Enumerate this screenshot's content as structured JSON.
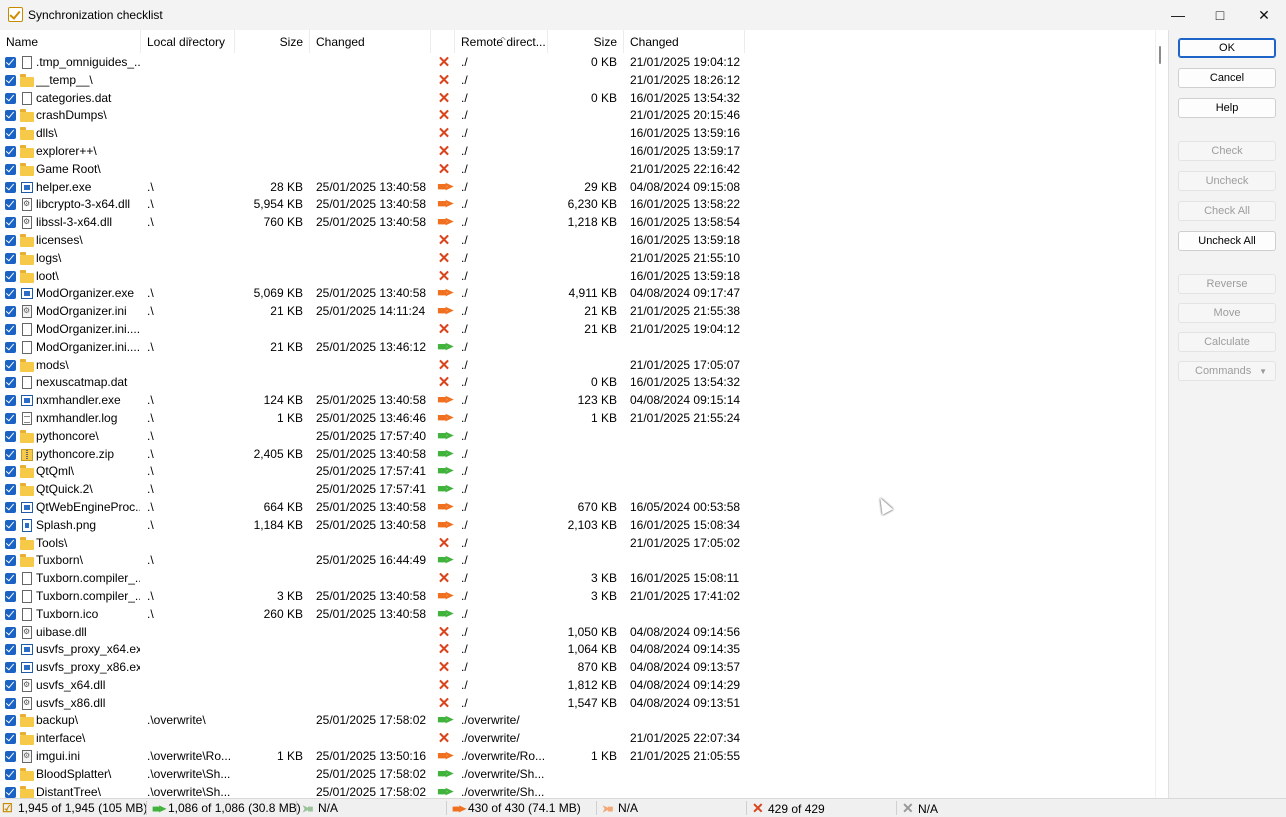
{
  "window": {
    "title": "Synchronization checklist"
  },
  "columns": {
    "name": "Name",
    "local_dir": "Local directory",
    "size": "Size",
    "changed": "Changed",
    "remote_dir": "Remote direct...",
    "remote_size": "Size",
    "remote_changed": "Changed"
  },
  "rows": [
    {
      "name": ".tmp_omniguides_...",
      "icon": "file",
      "ldir": "",
      "lsize": "",
      "lchanged": "",
      "action": "delete",
      "rdir": "./",
      "rsize": "0 KB",
      "rchanged": "21/01/2025 19:04:12"
    },
    {
      "name": "__temp__\\",
      "icon": "folder",
      "ldir": "",
      "lsize": "",
      "lchanged": "",
      "action": "delete",
      "rdir": "./",
      "rsize": "",
      "rchanged": "21/01/2025 18:26:12"
    },
    {
      "name": "categories.dat",
      "icon": "file",
      "ldir": "",
      "lsize": "",
      "lchanged": "",
      "action": "delete",
      "rdir": "./",
      "rsize": "0 KB",
      "rchanged": "16/01/2025 13:54:32"
    },
    {
      "name": "crashDumps\\",
      "icon": "folder",
      "ldir": "",
      "lsize": "",
      "lchanged": "",
      "action": "delete",
      "rdir": "./",
      "rsize": "",
      "rchanged": "21/01/2025 20:15:46"
    },
    {
      "name": "dlls\\",
      "icon": "folder",
      "ldir": "",
      "lsize": "",
      "lchanged": "",
      "action": "delete",
      "rdir": "./",
      "rsize": "",
      "rchanged": "16/01/2025 13:59:16"
    },
    {
      "name": "explorer++\\",
      "icon": "folder",
      "ldir": "",
      "lsize": "",
      "lchanged": "",
      "action": "delete",
      "rdir": "./",
      "rsize": "",
      "rchanged": "16/01/2025 13:59:17"
    },
    {
      "name": "Game Root\\",
      "icon": "folder",
      "ldir": "",
      "lsize": "",
      "lchanged": "",
      "action": "delete",
      "rdir": "./",
      "rsize": "",
      "rchanged": "21/01/2025 22:16:42"
    },
    {
      "name": "helper.exe",
      "icon": "exe",
      "ldir": ".\\",
      "lsize": "28 KB",
      "lchanged": "25/01/2025 13:40:58",
      "action": "update",
      "rdir": "./",
      "rsize": "29 KB",
      "rchanged": "04/08/2024 09:15:08"
    },
    {
      "name": "libcrypto-3-x64.dll",
      "icon": "dll",
      "ldir": ".\\",
      "lsize": "5,954 KB",
      "lchanged": "25/01/2025 13:40:58",
      "action": "update",
      "rdir": "./",
      "rsize": "6,230 KB",
      "rchanged": "16/01/2025 13:58:22"
    },
    {
      "name": "libssl-3-x64.dll",
      "icon": "dll",
      "ldir": ".\\",
      "lsize": "760 KB",
      "lchanged": "25/01/2025 13:40:58",
      "action": "update",
      "rdir": "./",
      "rsize": "1,218 KB",
      "rchanged": "16/01/2025 13:58:54"
    },
    {
      "name": "licenses\\",
      "icon": "folder",
      "ldir": "",
      "lsize": "",
      "lchanged": "",
      "action": "delete",
      "rdir": "./",
      "rsize": "",
      "rchanged": "16/01/2025 13:59:18"
    },
    {
      "name": "logs\\",
      "icon": "folder",
      "ldir": "",
      "lsize": "",
      "lchanged": "",
      "action": "delete",
      "rdir": "./",
      "rsize": "",
      "rchanged": "21/01/2025 21:55:10"
    },
    {
      "name": "loot\\",
      "icon": "folder",
      "ldir": "",
      "lsize": "",
      "lchanged": "",
      "action": "delete",
      "rdir": "./",
      "rsize": "",
      "rchanged": "16/01/2025 13:59:18"
    },
    {
      "name": "ModOrganizer.exe",
      "icon": "exe",
      "ldir": ".\\",
      "lsize": "5,069 KB",
      "lchanged": "25/01/2025 13:40:58",
      "action": "update",
      "rdir": "./",
      "rsize": "4,911 KB",
      "rchanged": "04/08/2024 09:17:47"
    },
    {
      "name": "ModOrganizer.ini",
      "icon": "ini",
      "ldir": ".\\",
      "lsize": "21 KB",
      "lchanged": "25/01/2025 14:11:24",
      "action": "update",
      "rdir": "./",
      "rsize": "21 KB",
      "rchanged": "21/01/2025 21:55:38"
    },
    {
      "name": "ModOrganizer.ini....",
      "icon": "file",
      "ldir": "",
      "lsize": "",
      "lchanged": "",
      "action": "delete",
      "rdir": "./",
      "rsize": "21 KB",
      "rchanged": "21/01/2025 19:04:12"
    },
    {
      "name": "ModOrganizer.ini....",
      "icon": "file",
      "ldir": ".\\",
      "lsize": "21 KB",
      "lchanged": "25/01/2025 13:46:12",
      "action": "new",
      "rdir": "./",
      "rsize": "",
      "rchanged": ""
    },
    {
      "name": "mods\\",
      "icon": "folder",
      "ldir": "",
      "lsize": "",
      "lchanged": "",
      "action": "delete",
      "rdir": "./",
      "rsize": "",
      "rchanged": "21/01/2025 17:05:07"
    },
    {
      "name": "nexuscatmap.dat",
      "icon": "file",
      "ldir": "",
      "lsize": "",
      "lchanged": "",
      "action": "delete",
      "rdir": "./",
      "rsize": "0 KB",
      "rchanged": "16/01/2025 13:54:32"
    },
    {
      "name": "nxmhandler.exe",
      "icon": "exe",
      "ldir": ".\\",
      "lsize": "124 KB",
      "lchanged": "25/01/2025 13:40:58",
      "action": "update",
      "rdir": "./",
      "rsize": "123 KB",
      "rchanged": "04/08/2024 09:15:14"
    },
    {
      "name": "nxmhandler.log",
      "icon": "log",
      "ldir": ".\\",
      "lsize": "1 KB",
      "lchanged": "25/01/2025 13:46:46",
      "action": "update",
      "rdir": "./",
      "rsize": "1 KB",
      "rchanged": "21/01/2025 21:55:24"
    },
    {
      "name": "pythoncore\\",
      "icon": "folder",
      "ldir": ".\\",
      "lsize": "",
      "lchanged": "25/01/2025 17:57:40",
      "action": "new",
      "rdir": "./",
      "rsize": "",
      "rchanged": ""
    },
    {
      "name": "pythoncore.zip",
      "icon": "zip",
      "ldir": ".\\",
      "lsize": "2,405 KB",
      "lchanged": "25/01/2025 13:40:58",
      "action": "new",
      "rdir": "./",
      "rsize": "",
      "rchanged": ""
    },
    {
      "name": "QtQml\\",
      "icon": "folder",
      "ldir": ".\\",
      "lsize": "",
      "lchanged": "25/01/2025 17:57:41",
      "action": "new",
      "rdir": "./",
      "rsize": "",
      "rchanged": ""
    },
    {
      "name": "QtQuick.2\\",
      "icon": "folder",
      "ldir": ".\\",
      "lsize": "",
      "lchanged": "25/01/2025 17:57:41",
      "action": "new",
      "rdir": "./",
      "rsize": "",
      "rchanged": ""
    },
    {
      "name": "QtWebEngineProc...",
      "icon": "exe",
      "ldir": ".\\",
      "lsize": "664 KB",
      "lchanged": "25/01/2025 13:40:58",
      "action": "update",
      "rdir": "./",
      "rsize": "670 KB",
      "rchanged": "16/05/2024 00:53:58"
    },
    {
      "name": "Splash.png",
      "icon": "img",
      "ldir": ".\\",
      "lsize": "1,184 KB",
      "lchanged": "25/01/2025 13:40:58",
      "action": "update",
      "rdir": "./",
      "rsize": "2,103 KB",
      "rchanged": "16/01/2025 15:08:34"
    },
    {
      "name": "Tools\\",
      "icon": "folder",
      "ldir": "",
      "lsize": "",
      "lchanged": "",
      "action": "delete",
      "rdir": "./",
      "rsize": "",
      "rchanged": "21/01/2025 17:05:02"
    },
    {
      "name": "Tuxborn\\",
      "icon": "folder",
      "ldir": ".\\",
      "lsize": "",
      "lchanged": "25/01/2025 16:44:49",
      "action": "new",
      "rdir": "./",
      "rsize": "",
      "rchanged": ""
    },
    {
      "name": "Tuxborn.compiler_...",
      "icon": "file",
      "ldir": "",
      "lsize": "",
      "lchanged": "",
      "action": "delete",
      "rdir": "./",
      "rsize": "3 KB",
      "rchanged": "16/01/2025 15:08:11"
    },
    {
      "name": "Tuxborn.compiler_...",
      "icon": "file",
      "ldir": ".\\",
      "lsize": "3 KB",
      "lchanged": "25/01/2025 13:40:58",
      "action": "update",
      "rdir": "./",
      "rsize": "3 KB",
      "rchanged": "21/01/2025 17:41:02"
    },
    {
      "name": "Tuxborn.ico",
      "icon": "ico",
      "ldir": ".\\",
      "lsize": "260 KB",
      "lchanged": "25/01/2025 13:40:58",
      "action": "new",
      "rdir": "./",
      "rsize": "",
      "rchanged": ""
    },
    {
      "name": "uibase.dll",
      "icon": "dll",
      "ldir": "",
      "lsize": "",
      "lchanged": "",
      "action": "delete",
      "rdir": "./",
      "rsize": "1,050 KB",
      "rchanged": "04/08/2024 09:14:56"
    },
    {
      "name": "usvfs_proxy_x64.exe",
      "icon": "exe",
      "ldir": "",
      "lsize": "",
      "lchanged": "",
      "action": "delete",
      "rdir": "./",
      "rsize": "1,064 KB",
      "rchanged": "04/08/2024 09:14:35"
    },
    {
      "name": "usvfs_proxy_x86.exe",
      "icon": "exe",
      "ldir": "",
      "lsize": "",
      "lchanged": "",
      "action": "delete",
      "rdir": "./",
      "rsize": "870 KB",
      "rchanged": "04/08/2024 09:13:57"
    },
    {
      "name": "usvfs_x64.dll",
      "icon": "dll",
      "ldir": "",
      "lsize": "",
      "lchanged": "",
      "action": "delete",
      "rdir": "./",
      "rsize": "1,812 KB",
      "rchanged": "04/08/2024 09:14:29"
    },
    {
      "name": "usvfs_x86.dll",
      "icon": "dll",
      "ldir": "",
      "lsize": "",
      "lchanged": "",
      "action": "delete",
      "rdir": "./",
      "rsize": "1,547 KB",
      "rchanged": "04/08/2024 09:13:51"
    },
    {
      "name": "backup\\",
      "icon": "folder",
      "ldir": ".\\overwrite\\",
      "lsize": "",
      "lchanged": "25/01/2025 17:58:02",
      "action": "new",
      "rdir": "./overwrite/",
      "rsize": "",
      "rchanged": ""
    },
    {
      "name": "interface\\",
      "icon": "folder",
      "ldir": "",
      "lsize": "",
      "lchanged": "",
      "action": "delete",
      "rdir": "./overwrite/",
      "rsize": "",
      "rchanged": "21/01/2025 22:07:34"
    },
    {
      "name": "imgui.ini",
      "icon": "ini",
      "ldir": ".\\overwrite\\Ro...",
      "lsize": "1 KB",
      "lchanged": "25/01/2025 13:50:16",
      "action": "update",
      "rdir": "./overwrite/Ro...",
      "rsize": "1 KB",
      "rchanged": "21/01/2025 21:05:55"
    },
    {
      "name": "BloodSplatter\\",
      "icon": "folder",
      "ldir": ".\\overwrite\\Sh...",
      "lsize": "",
      "lchanged": "25/01/2025 17:58:02",
      "action": "new",
      "rdir": "./overwrite/Sh...",
      "rsize": "",
      "rchanged": ""
    },
    {
      "name": "DistantTree\\",
      "icon": "folder",
      "ldir": ".\\overwrite\\Sh...",
      "lsize": "",
      "lchanged": "25/01/2025 17:58:02",
      "action": "new",
      "rdir": "./overwrite/Sh...",
      "rsize": "",
      "rchanged": ""
    }
  ],
  "buttons": {
    "ok": "OK",
    "cancel": "Cancel",
    "help": "Help",
    "check": "Check",
    "uncheck": "Uncheck",
    "check_all": "Check All",
    "uncheck_all": "Uncheck All",
    "reverse": "Reverse",
    "move": "Move",
    "calculate": "Calculate",
    "commands": "Commands"
  },
  "status": {
    "checked": "1,945 of 1,945 (105 MB)",
    "upload_new": "1,086 of 1,086 (30.8 MB)",
    "download_new": "N/A",
    "upload_update": "430 of 430 (74.1 MB)",
    "download_update": "N/A",
    "delete_remote": "429 of 429",
    "delete_local": "N/A"
  },
  "colors": {
    "delete": "#d9441c",
    "update": "#f07020",
    "new": "#41b33c",
    "checkbox": "#1a62c4",
    "folder": "#f7c948",
    "default_button": "#1e64c8"
  }
}
